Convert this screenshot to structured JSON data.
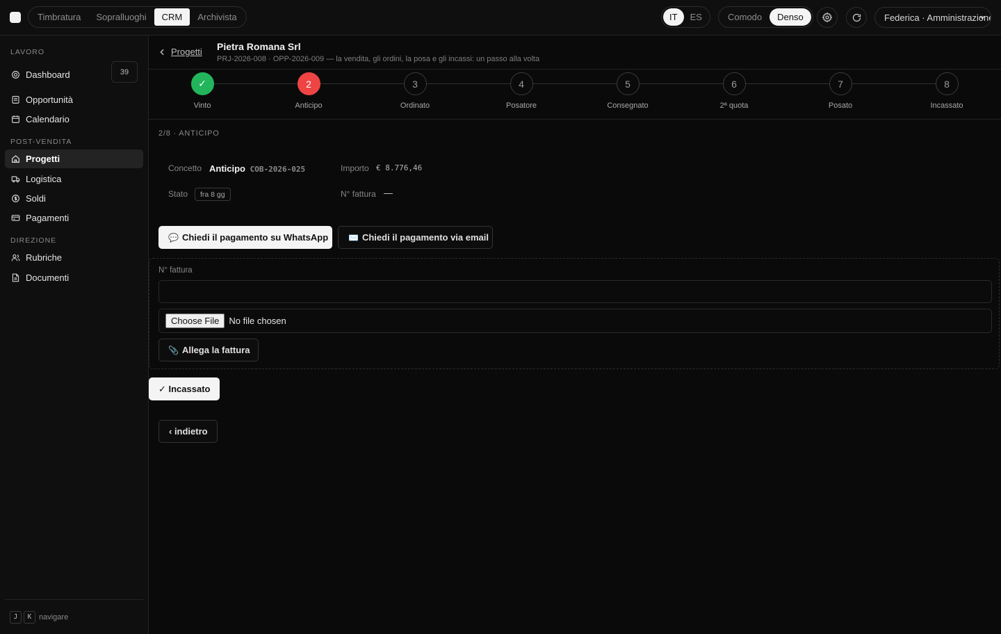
{
  "topbar": {
    "modules": [
      "Timbratura",
      "Sopralluoghi",
      "CRM",
      "Archivista"
    ],
    "active_module": "CRM",
    "languages": [
      "IT",
      "ES"
    ],
    "active_language": "IT",
    "density": [
      "Comodo",
      "Denso"
    ],
    "active_density": "Denso",
    "user": "Federica · Amministrazione"
  },
  "sidebar": {
    "sections": [
      {
        "title": "LAVORO",
        "items": [
          {
            "label": "Dashboard",
            "icon": "target-icon",
            "count": "39"
          },
          {
            "label": "Opportunità",
            "icon": "document-icon"
          },
          {
            "label": "Calendario",
            "icon": "calendar-icon"
          }
        ]
      },
      {
        "title": "POST-VENDITA",
        "items": [
          {
            "label": "Progetti",
            "icon": "home-icon",
            "active": true
          },
          {
            "label": "Logistica",
            "icon": "truck-icon"
          },
          {
            "label": "Soldi",
            "icon": "coin-icon"
          },
          {
            "label": "Pagamenti",
            "icon": "card-icon"
          }
        ]
      },
      {
        "title": "DIREZIONE",
        "items": [
          {
            "label": "Rubriche",
            "icon": "contacts-icon"
          },
          {
            "label": "Documenti",
            "icon": "file-icon"
          }
        ]
      }
    ],
    "footer": {
      "keys": [
        "J",
        "K"
      ],
      "label": "navigare"
    }
  },
  "header": {
    "back_label": "Progetti",
    "title": "Pietra Romana Srl",
    "subtitle": "PRJ-2026-008 · OPP-2026-009 — la vendita, gli ordini, la posa e gli incassi: un passo alla volta"
  },
  "stepper": {
    "steps": [
      {
        "num": "✓",
        "label": "Vinto",
        "state": "done"
      },
      {
        "num": "2",
        "label": "Anticipo",
        "state": "current"
      },
      {
        "num": "3",
        "label": "Ordinato",
        "state": "todo"
      },
      {
        "num": "4",
        "label": "Posatore",
        "state": "todo"
      },
      {
        "num": "5",
        "label": "Consegnato",
        "state": "todo"
      },
      {
        "num": "6",
        "label": "2ª quota",
        "state": "todo"
      },
      {
        "num": "7",
        "label": "Posato",
        "state": "todo"
      },
      {
        "num": "8",
        "label": "Incassato",
        "state": "todo"
      }
    ],
    "colors": {
      "done": "#22b55b",
      "current": "#ef4444"
    }
  },
  "detail": {
    "heading": "2/8 · ANTICIPO",
    "concept_label": "Concetto",
    "concept_value": "Anticipo",
    "concept_code": "COB-2026-025",
    "amount_label": "Importo",
    "amount_value": "€ 8.776,46",
    "status_label": "Stato",
    "status_value": "fra 8 gg",
    "invoice_label": "N° fattura",
    "invoice_value": "—"
  },
  "actions": {
    "whatsapp": "Chiedi il pagamento su WhatsApp",
    "whatsapp_icon": "💬",
    "email": "Chiedi il pagamento via email",
    "email_icon": "✉️"
  },
  "invoice_form": {
    "field_label": "N° fattura",
    "input_value": "",
    "file_button": "Choose File",
    "file_status": "No file chosen",
    "attach_button": "Allega la fattura",
    "attach_icon": "📎"
  },
  "confirm_button": "✓ Incassato",
  "back_button": "‹ indietro"
}
